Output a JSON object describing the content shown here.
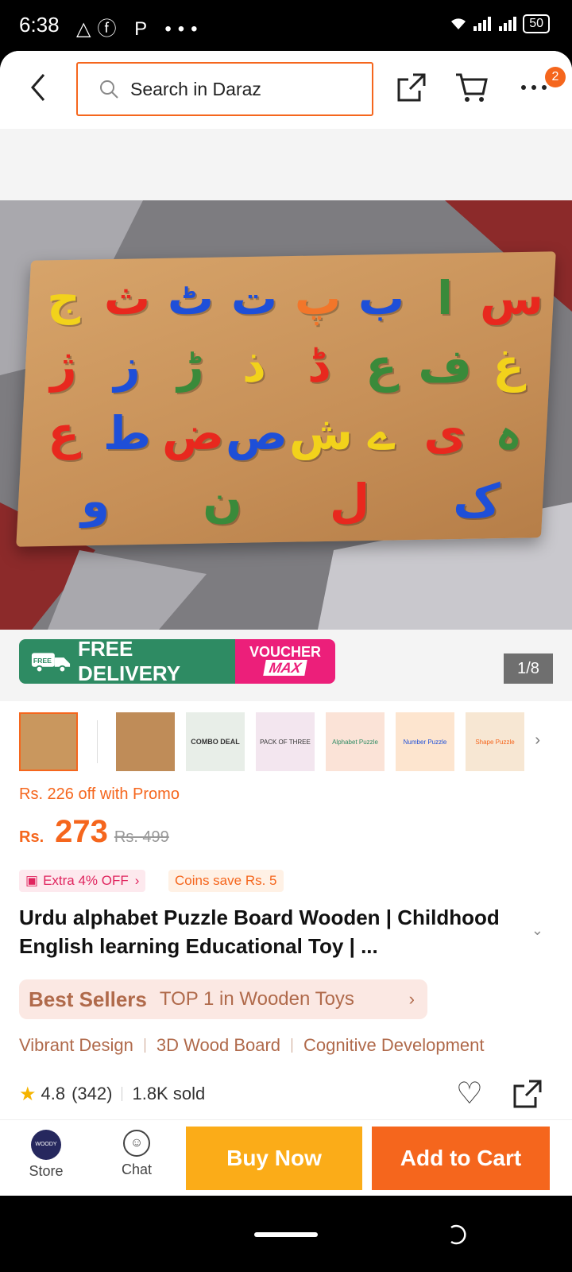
{
  "status": {
    "time": "6:38",
    "battery": "50",
    "left_icons": "△ⓕ P •••"
  },
  "header": {
    "search_placeholder": "Search in Daraz",
    "cart_badge": "2"
  },
  "gallery": {
    "counter": "1/8",
    "free_delivery_prefix": "FREE",
    "free_delivery": "FREE DELIVERY",
    "voucher_line1": "VOUCHER",
    "voucher_line2": "MAX",
    "thumbnails": [
      "thumb-1",
      "thumb-2",
      "COMBO DEAL",
      "PACK OF THREE",
      "Alphabet Puzzle",
      "Number Puzzle",
      "Shape Puzzle"
    ],
    "pieces": [
      {
        "ch": "ج",
        "color": "#f2d21b"
      },
      {
        "ch": "ث",
        "color": "#e8281e"
      },
      {
        "ch": "ٹ",
        "color": "#1e4fd8"
      },
      {
        "ch": "ت",
        "color": "#1e4fd8"
      },
      {
        "ch": "پ",
        "color": "#f2762a"
      },
      {
        "ch": "ب",
        "color": "#1e4fd8"
      },
      {
        "ch": "ا",
        "color": "#3a8a3a"
      },
      {
        "ch": "س",
        "color": "#e8281e"
      },
      {
        "ch": "ژ",
        "color": "#e8281e"
      },
      {
        "ch": "ز",
        "color": "#1e4fd8"
      },
      {
        "ch": "ڑ",
        "color": "#3a8a3a"
      },
      {
        "ch": "ذ",
        "color": "#f2d21b"
      },
      {
        "ch": "ڈ",
        "color": "#e8281e"
      },
      {
        "ch": "ع",
        "color": "#3a8a3a"
      },
      {
        "ch": "ف",
        "color": "#3a8a3a"
      },
      {
        "ch": "غ",
        "color": "#f2d21b"
      },
      {
        "ch": "ع",
        "color": "#e8281e"
      },
      {
        "ch": "ط",
        "color": "#1e4fd8"
      },
      {
        "ch": "ض",
        "color": "#e8281e"
      },
      {
        "ch": "ص",
        "color": "#1e4fd8"
      },
      {
        "ch": "ش",
        "color": "#f2d21b"
      },
      {
        "ch": "ے",
        "color": "#f2d21b"
      },
      {
        "ch": "ی",
        "color": "#e8281e"
      },
      {
        "ch": "ہ",
        "color": "#3a8a3a"
      },
      {
        "ch": "و",
        "color": "#1e4fd8"
      },
      {
        "ch": "ن",
        "color": "#3a8a3a"
      },
      {
        "ch": "ل",
        "color": "#e8281e"
      },
      {
        "ch": "ک",
        "color": "#1e4fd8"
      }
    ]
  },
  "pricing": {
    "promo": "Rs. 226 off with Promo",
    "currency": "Rs.",
    "price": "273",
    "original": "Rs. 499",
    "tag_extra": "Extra 4% OFF",
    "tag_coins": "Coins save Rs. 5"
  },
  "product": {
    "title": "Urdu alphabet Puzzle Board Wooden | Childhood English learning Educational Toy | ...",
    "best_label": "Best Sellers",
    "best_rank": "TOP 1 in Wooden Toys",
    "features": [
      "Vibrant Design",
      "3D Wood Board",
      "Cognitive Development"
    ],
    "rating": "4.8",
    "reviews": "(342)",
    "sold": "1.8K sold"
  },
  "actions": {
    "store": "Store",
    "store_logo_text": "WOODY",
    "chat": "Chat",
    "buy_now": "Buy Now",
    "add_to_cart": "Add to Cart"
  },
  "colors": {
    "accent": "#f5661d",
    "buy": "#fbac18",
    "delivery": "#2e8b63",
    "voucher": "#ec1f7a"
  }
}
